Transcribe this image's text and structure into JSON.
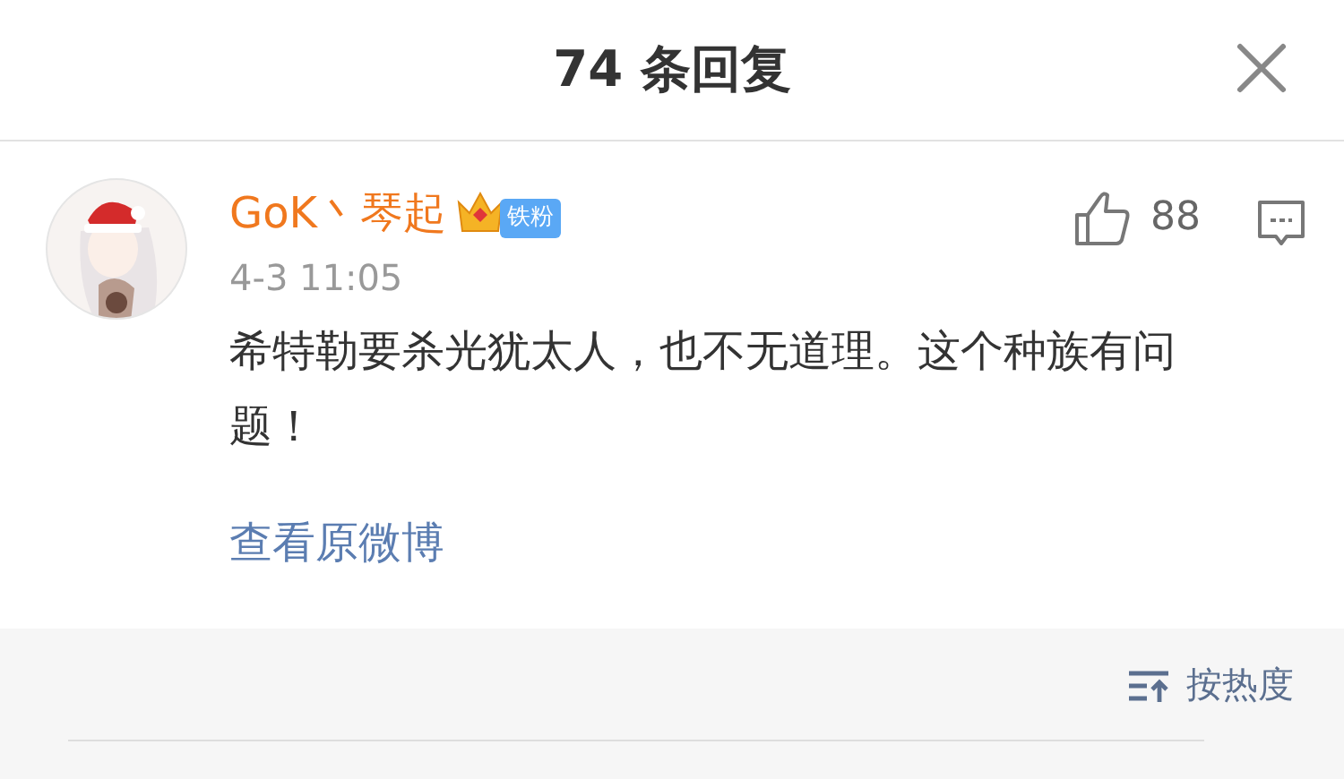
{
  "header": {
    "title": "74 条回复"
  },
  "comment": {
    "author": "GoK丶琴起",
    "badge": "铁粉",
    "time": "4-3 11:05",
    "likes": "88",
    "text": "希特勒要杀光犹太人，也不无道理。这个种族有问题！",
    "link": "查看原微博"
  },
  "sort": {
    "label": "按热度"
  }
}
